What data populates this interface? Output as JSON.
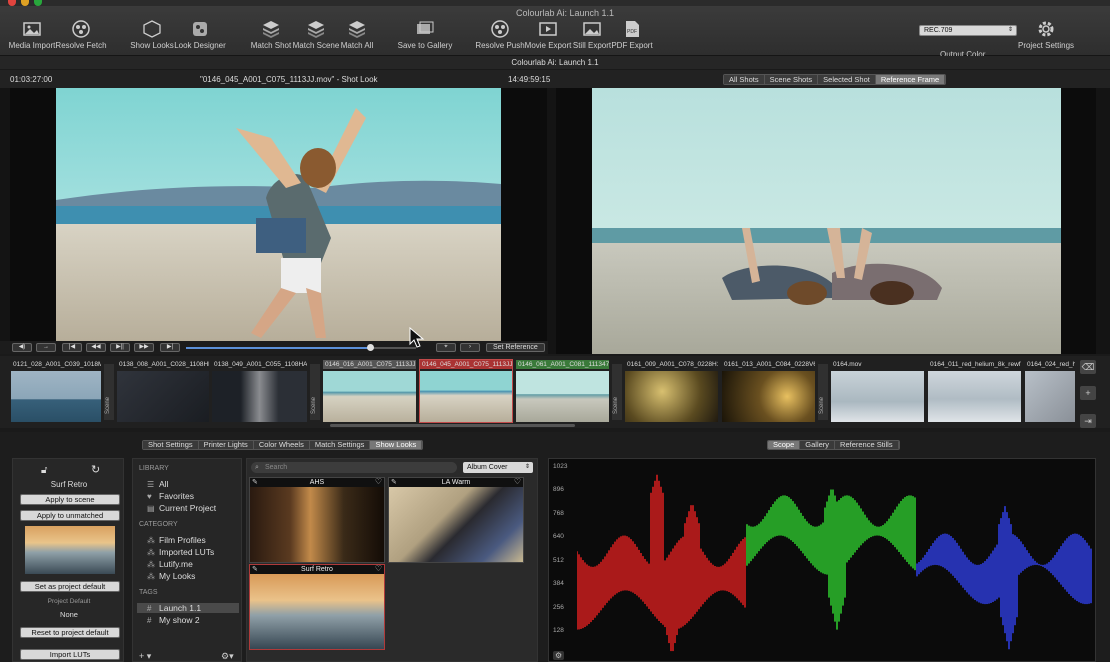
{
  "window": {
    "title": "Colourlab Ai: Launch 1.1"
  },
  "toolbar": {
    "buttons": [
      {
        "label": "Media Import",
        "icon": "media-import-icon"
      },
      {
        "label": "Resolve Fetch",
        "icon": "resolve-fetch-icon"
      },
      {
        "label": "Show Looks",
        "icon": "show-looks-icon"
      },
      {
        "label": "Look Designer",
        "icon": "look-designer-icon"
      },
      {
        "label": "Match Shot",
        "icon": "match-shot-icon"
      },
      {
        "label": "Match Scene",
        "icon": "match-scene-icon"
      },
      {
        "label": "Match All",
        "icon": "match-all-icon"
      },
      {
        "label": "Save to Gallery",
        "icon": "save-gallery-icon"
      },
      {
        "label": "Resolve Push",
        "icon": "resolve-push-icon"
      },
      {
        "label": "Movie Export",
        "icon": "movie-export-icon"
      },
      {
        "label": "Still Export",
        "icon": "still-export-icon"
      },
      {
        "label": "PDF Export",
        "icon": "pdf-export-icon"
      },
      {
        "label": "Project Settings",
        "icon": "gear-icon"
      }
    ],
    "output_color_value": "REC.709",
    "output_color_label": "Output Color"
  },
  "subtitle": "Colourlab Ai: Launch 1.1",
  "viewer": {
    "timecode_in": "01:03:27:00",
    "clip_title": "\"0146_045_A001_C075_1113JJ.mov\" - Shot Look",
    "timecode_out": "14:49:59:15",
    "modes": [
      "All Shots",
      "Scene Shots",
      "Selected Shot",
      "Reference Frame"
    ],
    "active_mode": "Reference Frame",
    "set_reference_label": "Set Reference",
    "playhead_fraction": 0.8
  },
  "thumbnails": [
    {
      "name": "0121_028_A001_C039_1018MK..."
    },
    {
      "name": "0138_008_A001_C028_1108HH..."
    },
    {
      "name": "0138_049_A001_C055_1108HA..."
    },
    {
      "name": "0146_016_A001_C075_1113JJ..."
    },
    {
      "name": "0146_045_A001_C075_1113JJ..."
    },
    {
      "name": "0146_061_A001_C081_111347.m..."
    },
    {
      "name": "0161_009_A001_C078_0228H1..."
    },
    {
      "name": "0161_013_A001_C084_0228V6..."
    },
    {
      "name": "0164.mov"
    },
    {
      "name": "0164_011_red_helium_8k_rewfil..."
    },
    {
      "name": "0164_024_red_he..."
    }
  ],
  "scene_label": "Scene",
  "lower_tabs": [
    "Shot Settings",
    "Printer Lights",
    "Color Wheels",
    "Match Settings",
    "Show Looks"
  ],
  "lower_active_tab": "Show Looks",
  "scope_tabs": [
    "Scope",
    "Gallery",
    "Reference Stills"
  ],
  "scope_active_tab": "Scope",
  "look_panel": {
    "look_name": "Surf Retro",
    "apply_scene": "Apply to scene",
    "apply_unmatched": "Apply to unmatched",
    "set_default": "Set as project default",
    "project_default_label": "Project Default",
    "project_default_value": "None",
    "reset_default": "Reset to project default",
    "import_luts": "Import LUTs"
  },
  "library": {
    "section_library": "LIBRARY",
    "library_items": [
      "All",
      "Favorites",
      "Current Project"
    ],
    "section_category": "CATEGORY",
    "category_items": [
      "Film Profiles",
      "Imported LUTs",
      "Lutify.me",
      "My Looks"
    ],
    "section_tags": "TAGS",
    "tag_items": [
      "Launch 1.1",
      "My show 2"
    ],
    "add_label": "+"
  },
  "looks": {
    "search_placeholder": "Search",
    "album_select": "Album Cover",
    "cards": [
      {
        "title": "AHS"
      },
      {
        "title": "LA Warm"
      },
      {
        "title": "Surf Retro"
      }
    ]
  },
  "scope": {
    "levels": [
      "1023",
      "896",
      "768",
      "640",
      "512",
      "384",
      "256",
      "128",
      "0"
    ],
    "colors": {
      "red": "#e02020",
      "green": "#30d030",
      "blue": "#3040e8"
    }
  }
}
